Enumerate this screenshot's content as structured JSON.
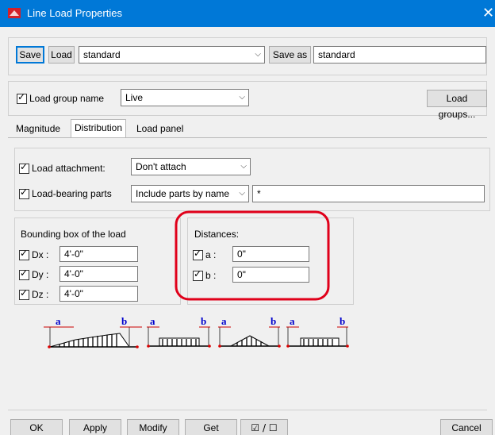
{
  "window": {
    "title": "Line Load Properties",
    "close_glyph": "✕"
  },
  "top_bar": {
    "save_label": "Save",
    "load_label": "Load",
    "load_value": "standard",
    "save_as_label": "Save as",
    "save_as_value": "standard"
  },
  "load_group": {
    "label": "Load group name",
    "value": "Live",
    "button": "Load groups..."
  },
  "tabs": [
    "Magnitude",
    "Distribution",
    "Load panel"
  ],
  "distribution": {
    "attachment_label": "Load attachment:",
    "attachment_value": "Don't attach",
    "bearing_label": "Load-bearing parts",
    "bearing_value": "Include parts by name",
    "bearing_filter": "*"
  },
  "bounding_box": {
    "title": "Bounding box of the load",
    "items": [
      {
        "label": "Dx :",
        "value": "4'-0\""
      },
      {
        "label": "Dy :",
        "value": "4'-0\""
      },
      {
        "label": "Dz :",
        "value": "4'-0\""
      }
    ]
  },
  "distances": {
    "title": "Distances:",
    "items": [
      {
        "label": "a :",
        "value": "0\""
      },
      {
        "label": "b :",
        "value": "0\""
      }
    ]
  },
  "diagram_letters": {
    "a": "a",
    "b": "b"
  },
  "bottom_bar": {
    "ok": "OK",
    "apply": "Apply",
    "modify": "Modify",
    "get": "Get",
    "toggle": "☑ / ☐",
    "cancel": "Cancel"
  },
  "colors": {
    "titlebar": "#0078d7",
    "highlight_ring": "#e0001a",
    "dialog_bg": "#f0f0f0"
  }
}
